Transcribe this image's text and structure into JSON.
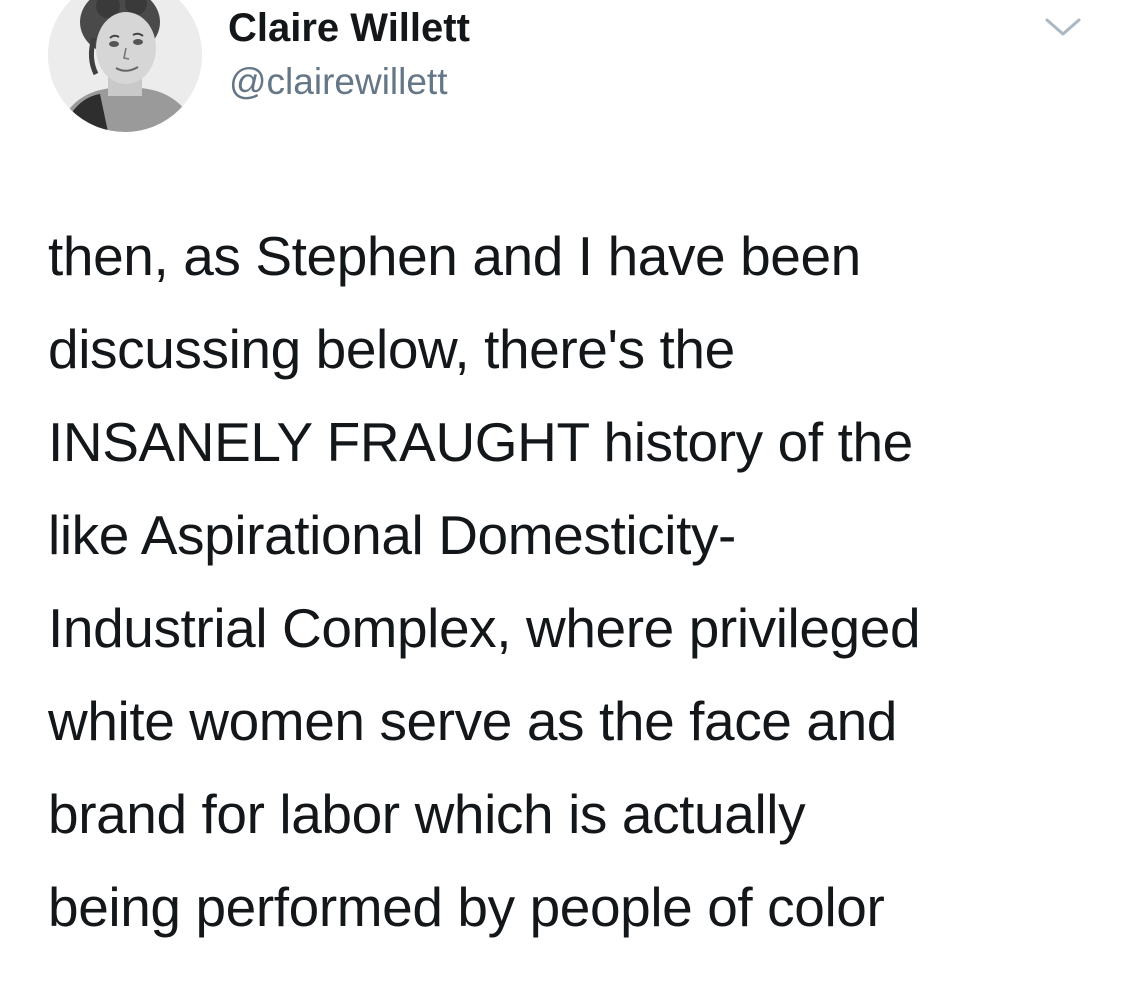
{
  "tweet": {
    "author": {
      "display_name": "Claire Willett",
      "handle": "@clairewillett",
      "avatar_icon": "profile-photo"
    },
    "menu_icon": "chevron-down-icon",
    "text_lines": [
      "then, as Stephen and I have been",
      "discussing below, there's the",
      "INSANELY FRAUGHT history of the",
      "like Aspirational Domesticity-",
      "Industrial Complex, where privileged",
      "white women serve as the face and",
      "brand for labor which is actually",
      "being performed by people of color"
    ]
  },
  "colors": {
    "text_primary": "#14171a",
    "text_secondary": "#657786",
    "caret": "#aab8c2",
    "background": "#ffffff"
  }
}
